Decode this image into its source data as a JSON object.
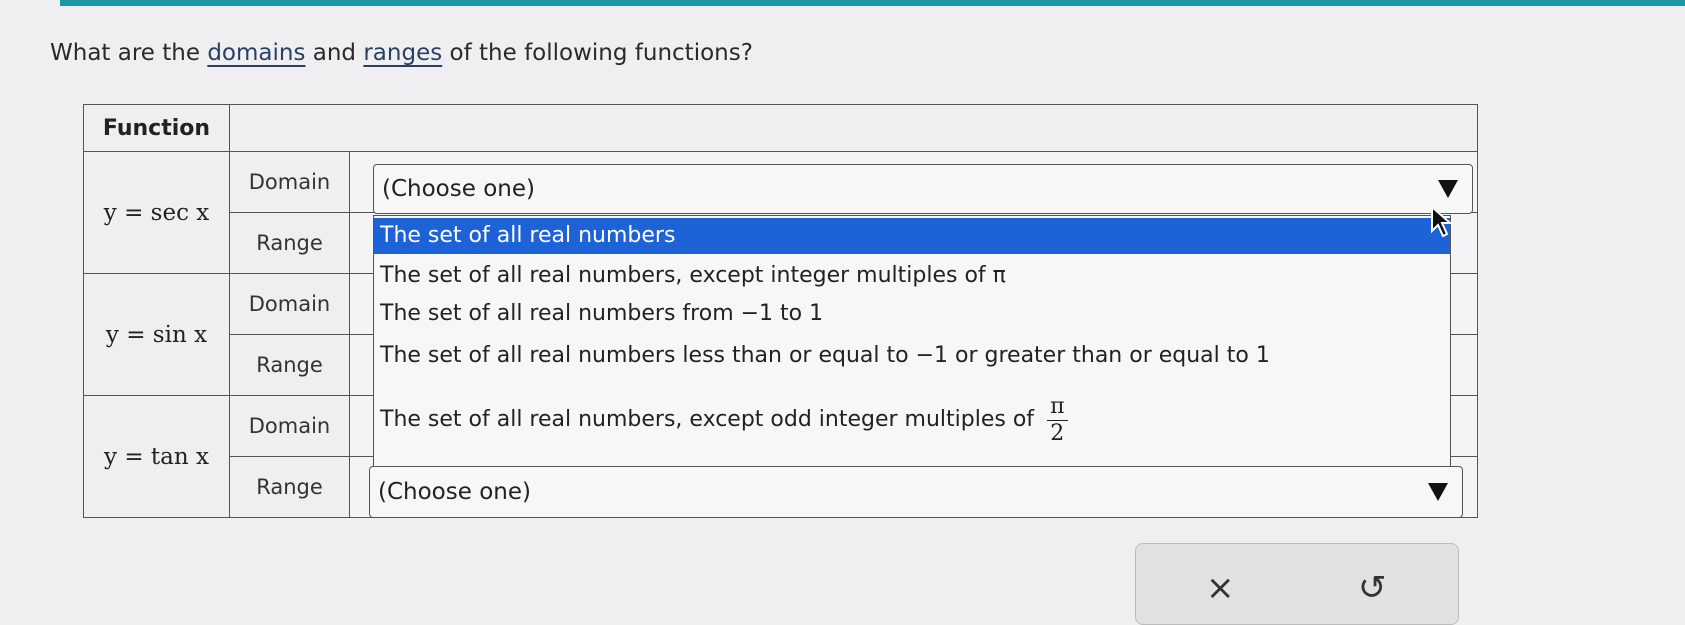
{
  "question": {
    "before": "What are the ",
    "link1": "domains",
    "middle": " and ",
    "link2": "ranges",
    "after": " of the following functions?"
  },
  "table": {
    "header": "Function",
    "rows": [
      {
        "function": "y = sec x",
        "labels": [
          "Domain",
          "Range"
        ]
      },
      {
        "function": "y = sin x",
        "labels": [
          "Domain",
          "Range"
        ]
      },
      {
        "function": "y = tan x",
        "labels": [
          "Domain",
          "Range"
        ]
      }
    ]
  },
  "top_select": {
    "value": "(Choose one)"
  },
  "bottom_select": {
    "value": "(Choose one)"
  },
  "dropdown_options": [
    "The set of all real numbers",
    "The set of all real numbers, except integer multiples of π",
    "The set of all real numbers from −1 to 1",
    "The set of all real numbers less than or equal to −1 or greater than or equal to 1",
    "The set of all real numbers, except odd integer multiples of"
  ],
  "fraction": {
    "num": "π",
    "den": "2"
  },
  "panel": {
    "close_glyph": "×",
    "reset_glyph": "↺"
  },
  "colors": {
    "accent": "#1a97a6",
    "selected": "#1e62d8"
  }
}
